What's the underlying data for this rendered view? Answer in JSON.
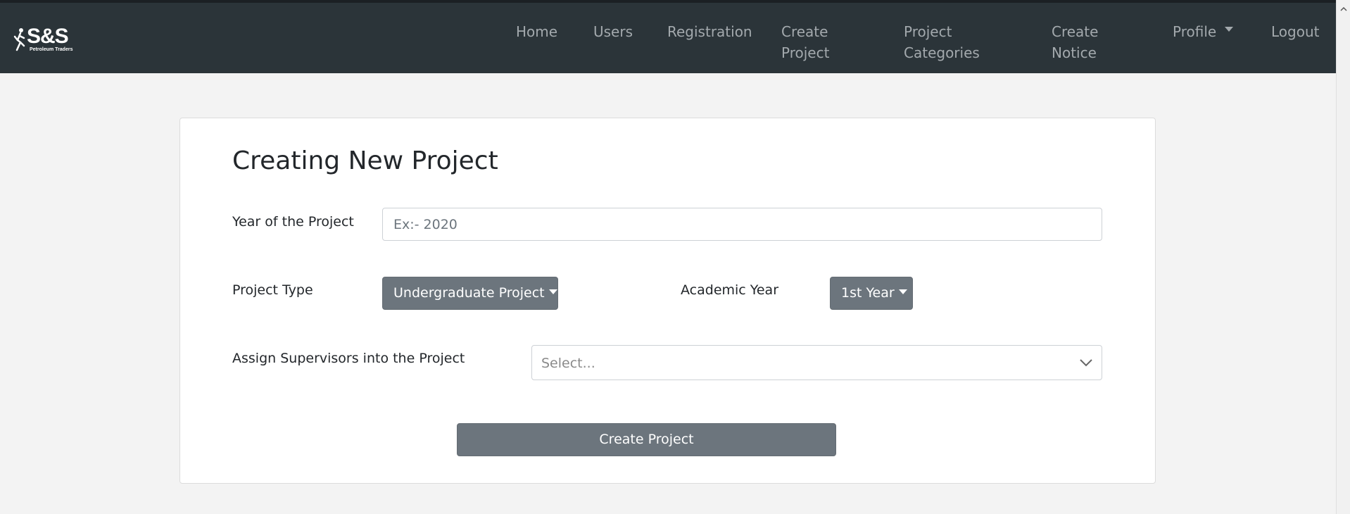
{
  "brand": {
    "name": "S&S",
    "subtitle": "Petroleum Traders"
  },
  "nav": {
    "home": "Home",
    "users": "Users",
    "registration": "Registration",
    "create_project_line1": "Create",
    "create_project_line2": "Project",
    "project_categories_line1": "Project",
    "project_categories_line2": "Categories",
    "create_notice_line1": "Create",
    "create_notice_line2": "Notice",
    "profile": "Profile",
    "logout": "Logout"
  },
  "form": {
    "title": "Creating New Project",
    "year_label": "Year of the Project",
    "year_placeholder": "Ex:- 2020",
    "project_type_label": "Project Type",
    "project_type_value": "Undergraduate Project",
    "academic_year_label": "Academic Year",
    "academic_year_value": "1st Year",
    "supervisors_label": "Assign Supervisors into the Project",
    "supervisors_placeholder": "Select...",
    "submit_label": "Create Project"
  },
  "icons": {
    "logo": "runner-logo-icon",
    "profile_caret": "caret-down-icon",
    "select_chevron": "chevron-down-icon",
    "scroll_up": "scroll-up-arrow-icon"
  },
  "colors": {
    "navbar": "#2b3439",
    "nav_text": "#a3a9ad",
    "button": "#6c757d",
    "page_bg": "#f3f3f3"
  }
}
